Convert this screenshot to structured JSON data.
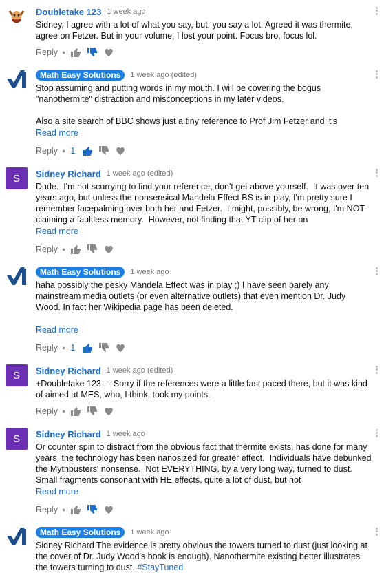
{
  "comments": [
    {
      "author": "Doubletake 123",
      "time": "1 week ago",
      "text": "Sidney, I agree with a lot of what you say, but, you say a lot. Agreed it was thermite, agree on Fetzer. But in your volume, I lost your point. Focus bro, focus lol.",
      "reply": "Reply",
      "more": "",
      "likes": ""
    },
    {
      "author": "Math Easy Solutions",
      "time": "1 week ago (edited)",
      "text": "Stop assuming and putting words in my mouth. I will be covering the bogus \"nanothermite\" distraction and misconceptions in my later videos.\n\nAlso a site search of BBC shows just a tiny reference to Prof Jim Fetzer and it's",
      "reply": "Reply",
      "more": "Read more",
      "likes": "1"
    },
    {
      "author": "Sidney Richard",
      "avatar_letter": "S",
      "time": "1 week ago (edited)",
      "text": "Dude.  I'm not scurrying to find your reference, don't get above yourself.  It was over ten years ago, but unless the nonsensical Mandela Effect BS is in play, I'm pretty sure I remember facepalming over both her and Fetzer.  I might, possibly, be wrong, I'm NOT claiming a faultless memory.  However, not finding that YT clip of her on",
      "reply": "Reply",
      "more": "Read more",
      "likes": ""
    },
    {
      "author": "Math Easy Solutions",
      "time": "1 week ago",
      "text": "haha possibly the pesky Mandela Effect was in play ;) I have seen barely any mainstream media outlets (or even alternative outlets) that even mention Dr. Judy Wood. In fact her Wikipedia page has been deleted.",
      "reply": "Reply",
      "more": "Read more",
      "likes": "1"
    },
    {
      "author": "Sidney Richard",
      "avatar_letter": "S",
      "time": "1 week ago (edited)",
      "text": "+Doubletake 123   - Sorry if the references were a little fast paced there, but it was kind of aimed at MES, who, I think, took my points.",
      "reply": "Reply",
      "more": "",
      "likes": ""
    },
    {
      "author": "Sidney Richard",
      "avatar_letter": "S",
      "time": "1 week ago",
      "text": "Or counter spin to distract from the obvious fact that thermite exists, has done for many years, the technology has been nanosized for greater effect.  Individuals have debunked the Mythbusters' nonsense.  Not EVERYTHING, by a very long way, turned to dust.  Small fragments consonant with HE effects, quite a lot of dust, but not",
      "reply": "Reply",
      "more": "Read more",
      "likes": ""
    },
    {
      "author": "Math Easy Solutions",
      "time": "1 week ago",
      "text": "Sidney Richard The evidence is pretty obvious the towers turned to dust (just looking at the cover of Dr. Judy Wood's book is enough). Nanothermite existing better illustrates the towers turning to dust. ",
      "hashtag": "#StayTuned",
      "reply": "",
      "more": "",
      "likes": ""
    }
  ],
  "colors": {
    "link": "#1a6cd1",
    "badge": "#1a7fe6",
    "sidney_avatar": "#6a2fb3"
  }
}
